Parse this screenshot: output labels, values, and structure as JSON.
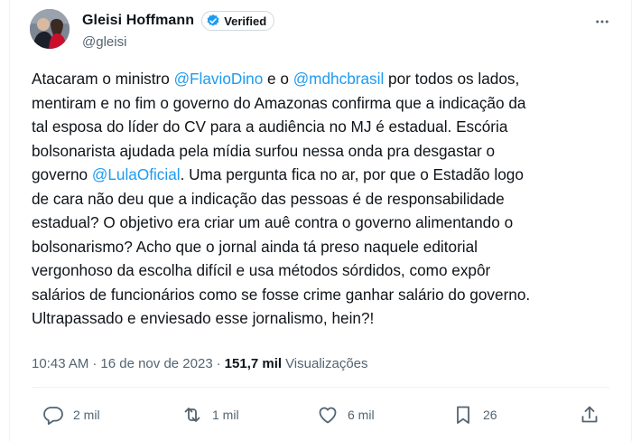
{
  "author": {
    "name": "Gleisi Hoffmann",
    "handle": "@gleisi",
    "verified_label": "Verified"
  },
  "tweet": {
    "lines": [
      [
        {
          "t": "Atacaram o ministro ",
          "m": false
        },
        {
          "t": "@FlavioDino",
          "m": true
        },
        {
          "t": " e o ",
          "m": false
        },
        {
          "t": "@mdhcbrasil",
          "m": true
        },
        {
          "t": " por todos os lados,",
          "m": false
        }
      ],
      [
        {
          "t": "mentiram e no fim o governo do Amazonas confirma que a indicação da",
          "m": false
        }
      ],
      [
        {
          "t": "tal esposa do líder do CV para a audiência no MJ é estadual. Escória",
          "m": false
        }
      ],
      [
        {
          "t": "bolsonarista ajudada pela mídia surfou nessa onda pra desgastar o",
          "m": false
        }
      ],
      [
        {
          "t": "governo ",
          "m": false
        },
        {
          "t": "@LulaOficial",
          "m": true
        },
        {
          "t": ". Uma pergunta fica no ar, por que o Estadão logo",
          "m": false
        }
      ],
      [
        {
          "t": "de cara não deu que a indicação das pessoas é de responsabilidade",
          "m": false
        }
      ],
      [
        {
          "t": "estadual? O objetivo era criar um auê contra o governo alimentando o",
          "m": false
        }
      ],
      [
        {
          "t": "bolsonarismo? Acho que o jornal ainda tá preso naquele editorial",
          "m": false
        }
      ],
      [
        {
          "t": "vergonhoso da escolha difícil e usa métodos sórdidos, como expôr",
          "m": false
        }
      ],
      [
        {
          "t": "salários de funcionários como se fosse crime ganhar salário do governo.",
          "m": false
        }
      ],
      [
        {
          "t": "Ultrapassado e enviesado esse jornalismo, hein?!",
          "m": false
        }
      ]
    ]
  },
  "meta": {
    "time": "10:43 AM",
    "separator": "·",
    "date": "16 de nov de 2023",
    "views_count": "151,7 mil",
    "views_label": "Visualizações"
  },
  "actions": {
    "replies": "2 mil",
    "retweets": "1 mil",
    "likes": "6 mil",
    "bookmarks": "26"
  },
  "colors": {
    "link": "#1d9bf0",
    "verified_badge": "#1d9bf0",
    "text": "#0f1419",
    "secondary": "#536471"
  },
  "icons": {
    "more": "more-dots-icon",
    "reply": "reply-bubble-icon",
    "retweet": "retweet-arrows-icon",
    "like": "heart-icon",
    "bookmark": "bookmark-icon",
    "share": "share-upload-icon",
    "verified": "verified-badge-icon"
  }
}
